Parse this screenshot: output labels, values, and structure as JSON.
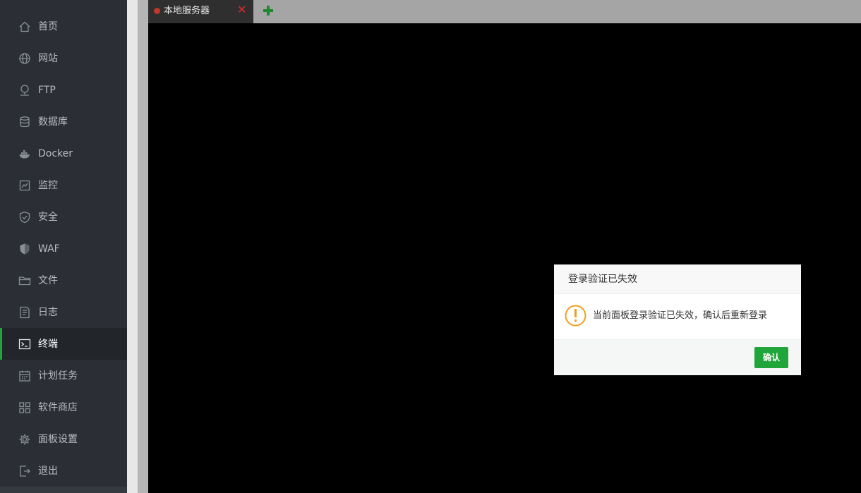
{
  "sidebar": {
    "items": [
      {
        "label": "首页",
        "icon": "home-icon"
      },
      {
        "label": "网站",
        "icon": "globe-icon"
      },
      {
        "label": "FTP",
        "icon": "ftp-icon"
      },
      {
        "label": "数据库",
        "icon": "database-icon"
      },
      {
        "label": "Docker",
        "icon": "docker-icon"
      },
      {
        "label": "监控",
        "icon": "monitor-icon"
      },
      {
        "label": "安全",
        "icon": "shield-check-icon"
      },
      {
        "label": "WAF",
        "icon": "waf-shield-icon"
      },
      {
        "label": "文件",
        "icon": "folder-icon"
      },
      {
        "label": "日志",
        "icon": "log-icon"
      },
      {
        "label": "终端",
        "icon": "terminal-icon",
        "active": true
      },
      {
        "label": "计划任务",
        "icon": "calendar-icon"
      },
      {
        "label": "软件商店",
        "icon": "apps-grid-icon"
      },
      {
        "label": "面板设置",
        "icon": "gear-icon"
      },
      {
        "label": "退出",
        "icon": "logout-icon"
      }
    ]
  },
  "tabs": {
    "items": [
      {
        "label": "本地服务器",
        "status_color": "#c0392b"
      }
    ],
    "close_glyph": "✕",
    "add_icon": "plus-icon"
  },
  "dialog": {
    "title": "登录验证已失效",
    "message": "当前面板登录验证已失效，确认后重新登录",
    "icon": "warning-exclamation-icon",
    "confirm_label": "确认"
  },
  "colors": {
    "accent": "#20a53a",
    "sidebar_bg": "#2b2f35",
    "terminal_bg": "#000000",
    "warning": "#f0a020"
  }
}
